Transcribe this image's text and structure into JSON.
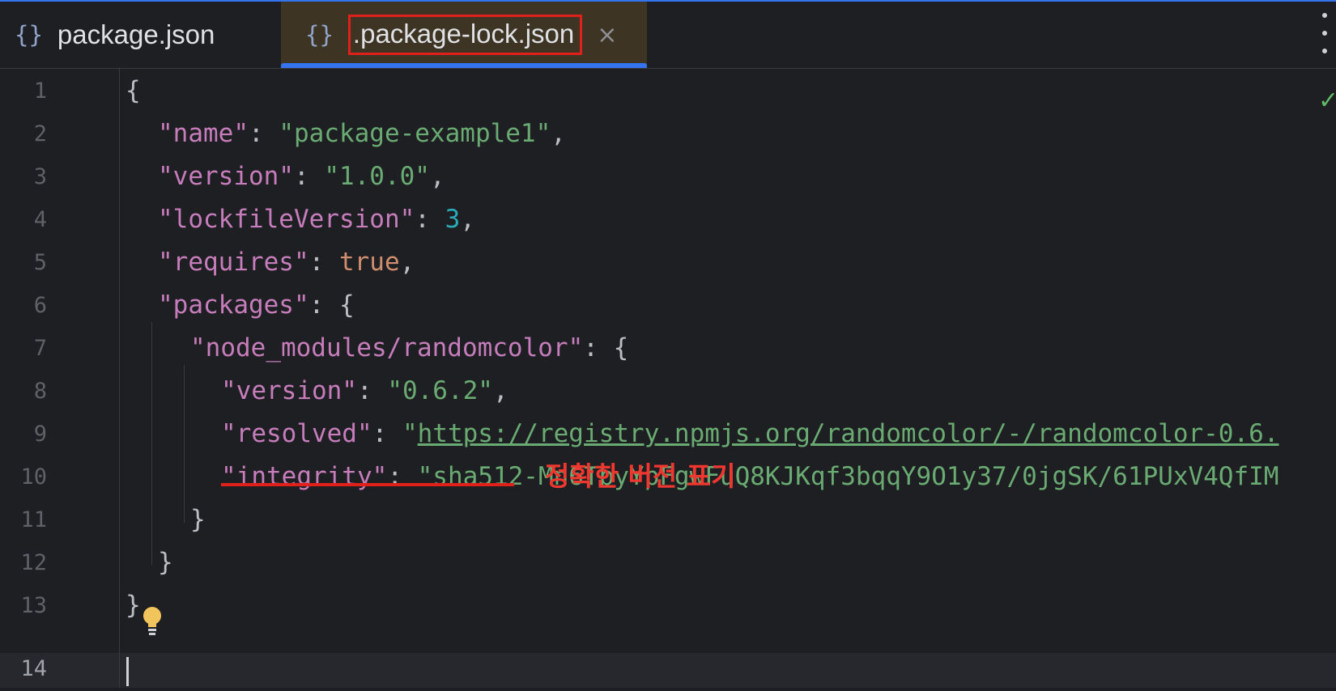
{
  "tabs": [
    {
      "icon": "{}",
      "label": "package.json",
      "active": false
    },
    {
      "icon": "{}",
      "label": ".package-lock.json",
      "active": true,
      "close": "×"
    }
  ],
  "colors": {
    "accent": "#3574f0",
    "annotation": "#e0201b",
    "key": "#c77dbb",
    "string": "#6aab73",
    "number": "#2aacb8",
    "keyword": "#cf8e6d"
  },
  "editor": {
    "line_numbers": [
      "1",
      "2",
      "3",
      "4",
      "5",
      "6",
      "7",
      "8",
      "9",
      "10",
      "11",
      "12",
      "13",
      "14"
    ],
    "current_line": "14",
    "lines": {
      "l1": {
        "open": "{"
      },
      "l2": {
        "key": "\"name\"",
        "colon": ": ",
        "value": "\"package-example1\"",
        "end": ","
      },
      "l3": {
        "key": "\"version\"",
        "colon": ": ",
        "value": "\"1.0.0\"",
        "end": ","
      },
      "l4": {
        "key": "\"lockfileVersion\"",
        "colon": ": ",
        "value": "3",
        "end": ","
      },
      "l5": {
        "key": "\"requires\"",
        "colon": ": ",
        "value": "true",
        "end": ","
      },
      "l6": {
        "key": "\"packages\"",
        "colon": ": ",
        "open": "{"
      },
      "l7": {
        "key": "\"node_modules/randomcolor\"",
        "colon": ": ",
        "open": "{"
      },
      "l8": {
        "key": "\"version\"",
        "colon": ": ",
        "value": "\"0.6.2\"",
        "end": ","
      },
      "l9": {
        "key": "\"resolved\"",
        "colon": ": ",
        "quote": "\"",
        "url": "https://registry.npmjs.org/randomcolor/-/randomcolor-0.6."
      },
      "l10": {
        "key": "\"integrity\"",
        "colon": ": ",
        "value": "\"sha512-Mn6TbyYpFgwFuQ8KJKqf3bqqY9O1y37/0jgSK/61PUxV4QfIM"
      },
      "l11": {
        "close": "}"
      },
      "l12": {
        "close": "}"
      },
      "l13": {
        "close": "}"
      }
    }
  },
  "annotation": {
    "text": "정확한 버전 표기"
  },
  "icons": {
    "tab_file": "json-braces-icon",
    "close": "close-icon",
    "more": "kebab-menu-icon",
    "inspection": "checkmark-icon",
    "intention": "lightbulb-icon"
  }
}
